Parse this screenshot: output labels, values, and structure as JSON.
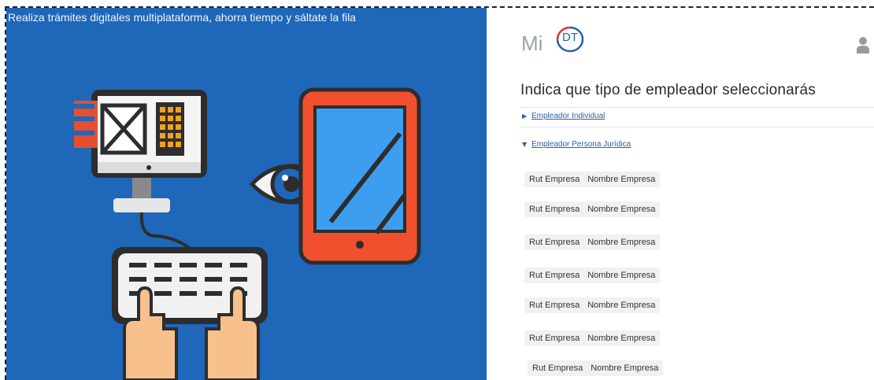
{
  "banner": {
    "tagline": "Realiza trámites digitales multiplataforma, ahorra tiempo y sáltate la fila"
  },
  "header": {
    "logo_prefix": "Mi",
    "logo_badge": "DT"
  },
  "main": {
    "title": "Indica que tipo de empleador seleccionarás",
    "accordion": [
      {
        "label": "Empleador Individual",
        "state": "collapsed"
      },
      {
        "label": "Empleador Persona Jurídica",
        "state": "expanded"
      }
    ],
    "companies": [
      {
        "rut": "Rut Empresa",
        "name": "Nombre Empresa"
      },
      {
        "rut": "Rut Empresa",
        "name": "Nombre Empresa"
      },
      {
        "rut": "Rut Empresa",
        "name": "Nombre Empresa"
      },
      {
        "rut": "Rut Empresa",
        "name": "Nombre Empresa"
      },
      {
        "rut": "Rut Empresa",
        "name": "Nombre Empresa"
      },
      {
        "rut": "Rut Empresa",
        "name": "Nombre Empresa"
      },
      {
        "rut": "Rut Empresa",
        "name": "Nombre Empresa"
      }
    ]
  },
  "colors": {
    "banner_bg": "#1f67b9",
    "link": "#2b5fa8",
    "logo_blue": "#2a5db0",
    "logo_red": "#e0322b"
  },
  "icons": [
    "desktop-computer-icon",
    "keyboard-hands-icon",
    "eye-icon",
    "tablet-icon",
    "user-icon"
  ]
}
